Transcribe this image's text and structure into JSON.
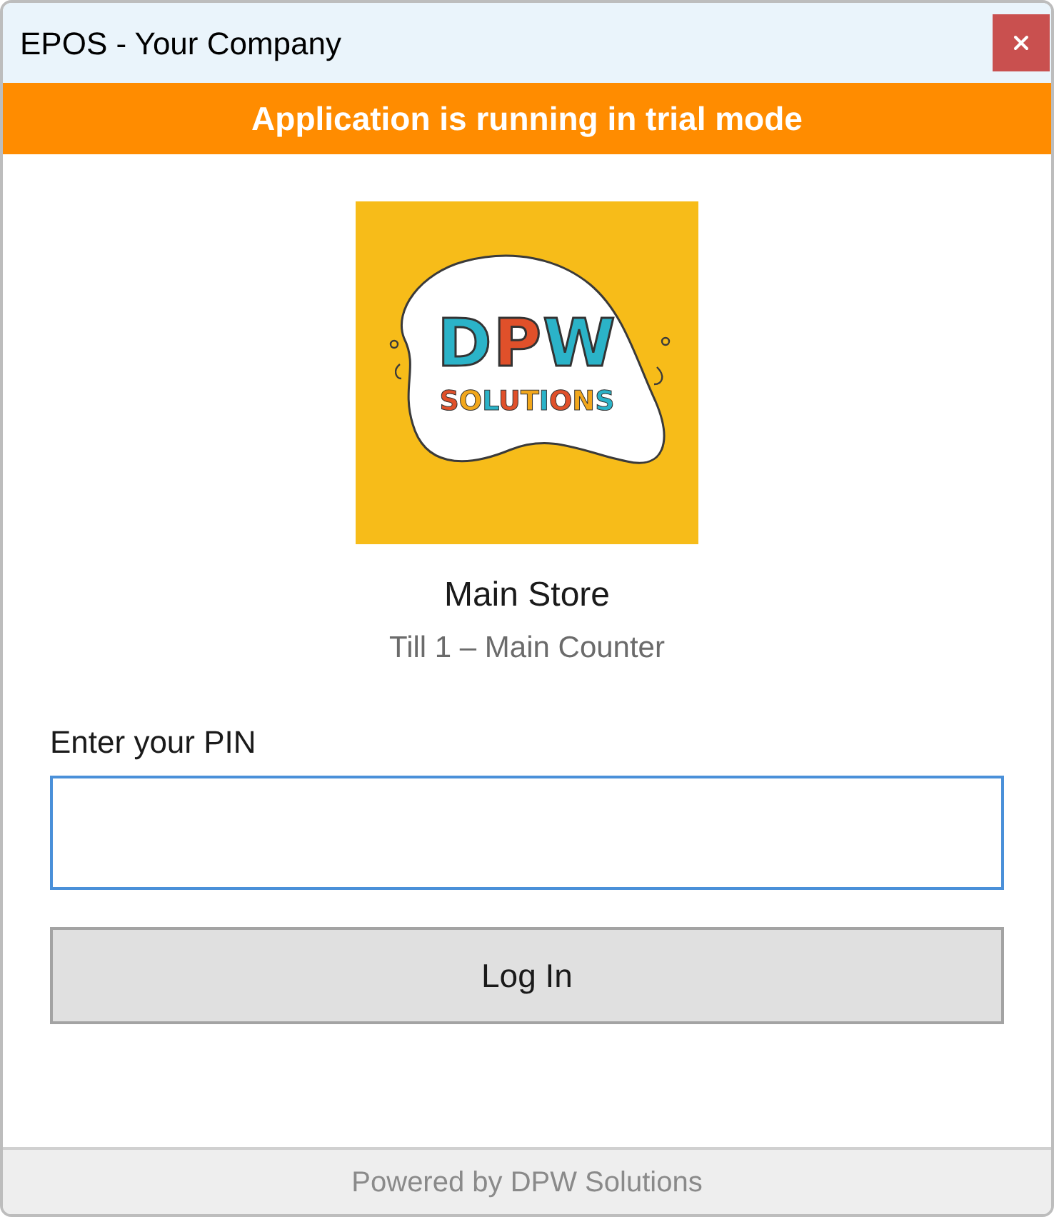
{
  "window": {
    "title": "EPOS - Your Company"
  },
  "banner": {
    "text": "Application is running in trial mode"
  },
  "logo": {
    "title": "DPW",
    "subtitle": "SOLUTIONS"
  },
  "store": {
    "name": "Main Store",
    "till": "Till 1 – Main Counter"
  },
  "pin_field": {
    "label": "Enter your PIN",
    "focused": true
  },
  "login_button": {
    "label": "Log In"
  },
  "footer": {
    "text": "Powered by DPW Solutions"
  }
}
